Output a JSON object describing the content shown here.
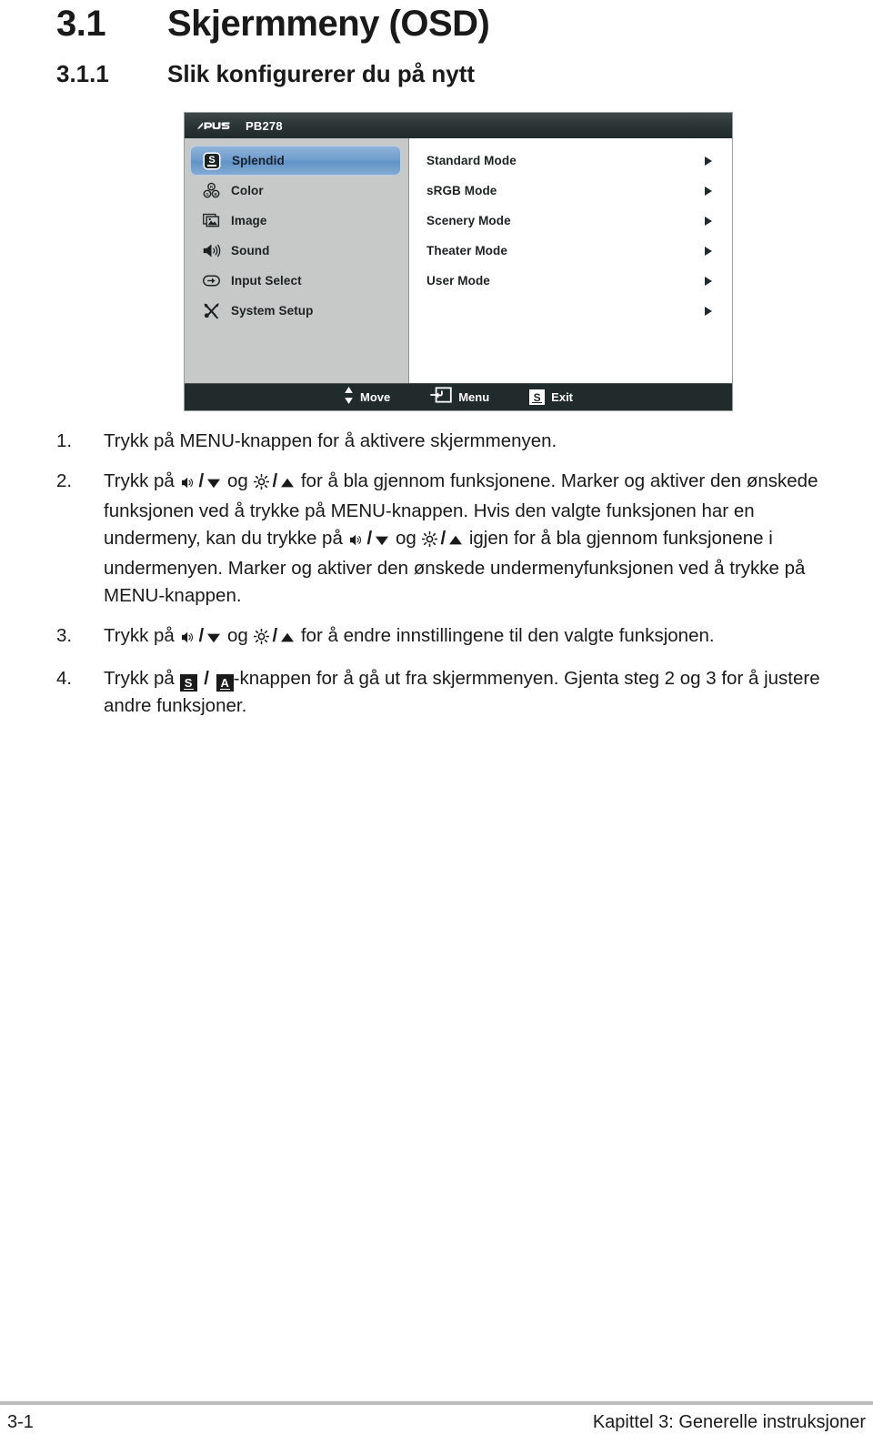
{
  "headings": {
    "h1_number": "3.1",
    "h1_title": "Skjermmeny (OSD)",
    "h2_number": "3.1.1",
    "h2_title": "Slik konfigurerer du på nytt"
  },
  "osd": {
    "brand": "ASUS",
    "model": "PB278",
    "menu_items": [
      {
        "label": "Splendid",
        "icon": "splendid-s-icon",
        "selected": true
      },
      {
        "label": "Color",
        "icon": "color-rgb-icon",
        "selected": false
      },
      {
        "label": "Image",
        "icon": "image-picture-icon",
        "selected": false
      },
      {
        "label": "Sound",
        "icon": "sound-speaker-icon",
        "selected": false
      },
      {
        "label": "Input Select",
        "icon": "input-arrow-icon",
        "selected": false
      },
      {
        "label": "System Setup",
        "icon": "system-tools-icon",
        "selected": false
      }
    ],
    "submenu_items": [
      {
        "label": "Standard Mode",
        "arrow": true
      },
      {
        "label": "sRGB Mode",
        "arrow": true
      },
      {
        "label": "Scenery Mode",
        "arrow": true
      },
      {
        "label": "Theater Mode",
        "arrow": true
      },
      {
        "label": "User Mode",
        "arrow": true
      },
      {
        "label": "",
        "arrow": true
      }
    ],
    "footer": {
      "move_label": "Move",
      "menu_label": "Menu",
      "exit_label": "Exit",
      "exit_key": "S"
    },
    "colors": {
      "titlebar": "#2c3636",
      "sidebar": "#c7c9c9",
      "panel": "#ffffff",
      "footer": "#212b2b",
      "selection": "#6d9ccd"
    }
  },
  "steps": [
    {
      "number": "1.",
      "parts": [
        {
          "type": "text",
          "value": "Trykk på MENU-knappen for å aktivere skjermmenyen."
        }
      ]
    },
    {
      "number": "2.",
      "parts": [
        {
          "type": "text",
          "value": "Trykk på "
        },
        {
          "type": "icon",
          "value": "sound-speaker-icon"
        },
        {
          "type": "text",
          "value": "/"
        },
        {
          "type": "icon",
          "value": "triangle-down-icon"
        },
        {
          "type": "text",
          "value": " og "
        },
        {
          "type": "icon",
          "value": "brightness-sun-icon"
        },
        {
          "type": "text",
          "value": "/"
        },
        {
          "type": "icon",
          "value": "triangle-up-icon"
        },
        {
          "type": "text",
          "value": " for å bla gjennom funksjonene. Marker og aktiver den ønskede funksjonen ved å trykke på MENU-knappen. Hvis den valgte funksjonen har en undermeny, kan du trykke på "
        },
        {
          "type": "icon",
          "value": "sound-speaker-icon"
        },
        {
          "type": "text",
          "value": "/"
        },
        {
          "type": "icon",
          "value": "triangle-down-icon"
        },
        {
          "type": "text",
          "value": " og "
        },
        {
          "type": "icon",
          "value": "brightness-sun-icon"
        },
        {
          "type": "text",
          "value": "/"
        },
        {
          "type": "icon",
          "value": "triangle-up-icon"
        },
        {
          "type": "text",
          "value": " igjen for å bla gjennom funksjonene i undermenyen. Marker og aktiver den ønskede undermenyfunksjonen ved å trykke på MENU-knappen."
        }
      ]
    },
    {
      "number": "3.",
      "parts": [
        {
          "type": "text",
          "value": "Trykk på "
        },
        {
          "type": "icon",
          "value": "sound-speaker-icon"
        },
        {
          "type": "text",
          "value": "/"
        },
        {
          "type": "icon",
          "value": "triangle-down-icon"
        },
        {
          "type": "text",
          "value": " og "
        },
        {
          "type": "icon",
          "value": "brightness-sun-icon"
        },
        {
          "type": "text",
          "value": "/"
        },
        {
          "type": "icon",
          "value": "triangle-up-icon"
        },
        {
          "type": "text",
          "value": " for å endre innstillingene til den valgte funksjonen."
        }
      ]
    },
    {
      "number": "4.",
      "parts": [
        {
          "type": "text",
          "value": "Trykk på "
        },
        {
          "type": "key",
          "value": "S"
        },
        {
          "type": "text",
          "value": " / "
        },
        {
          "type": "key",
          "value": "A"
        },
        {
          "type": "text",
          "value": "-knappen for å gå ut fra skjermmenyen. Gjenta steg 2 og 3 for å justere andre funksjoner."
        }
      ]
    }
  ],
  "page_footer": {
    "page_number": "3-1",
    "chapter": "Kapittel 3: Generelle instruksjoner"
  }
}
